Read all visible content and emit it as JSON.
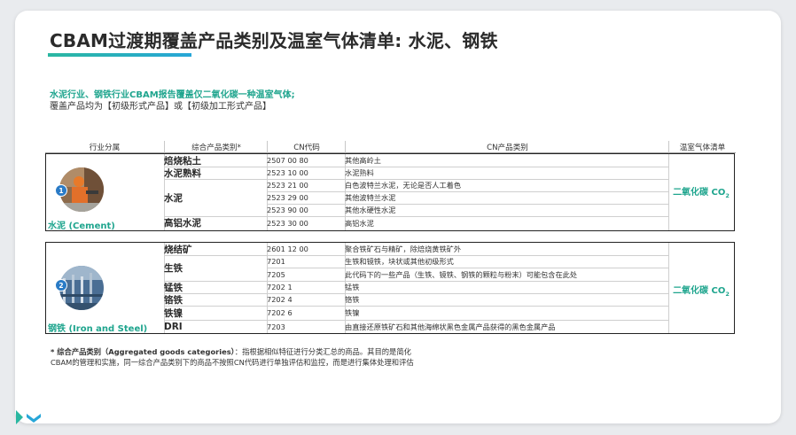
{
  "slide": {
    "title": "CBAM过渡期覆盖产品类别及温室气体清单: 水泥、钢铁",
    "subtitle_line1": "水泥行业、钢铁行业CBAM报告覆盖仅二氧化碳一种温室气体;",
    "subtitle_line2": "覆盖产品均为【初级形式产品】或【初级加工形式产品】"
  },
  "table": {
    "headers": [
      "行业分属",
      "综合产品类别*",
      "CN代码",
      "CN产品类别",
      "温室气体清单"
    ],
    "groups": [
      {
        "badge": "1",
        "sector": "水泥 (Cement)",
        "gas": "二氧化碳 CO",
        "gas_sub": "2",
        "categories": [
          "焙烧粘土",
          "水泥熟料",
          "水泥",
          "高铝水泥"
        ],
        "rows": [
          {
            "code": "2507 00 80",
            "desc": "其他高岭土"
          },
          {
            "code": "2523 10 00",
            "desc": "水泥熟料"
          },
          {
            "code": "2523 21 00",
            "desc": "白色波特兰水泥，无论是否人工着色"
          },
          {
            "code": "2523 29 00",
            "desc": "其他波特兰水泥"
          },
          {
            "code": "2523 90 00",
            "desc": "其他水硬性水泥"
          },
          {
            "code": "2523 30 00",
            "desc": "高铝水泥"
          }
        ]
      },
      {
        "badge": "2",
        "sector": "钢铁  (Iron and Steel)",
        "gas": "二氧化碳 CO",
        "gas_sub": "2",
        "categories": [
          "烧结矿",
          "生铁",
          "锰铁",
          "铬铁",
          "铁镍",
          "DRI"
        ],
        "rows": [
          {
            "code": "2601 12 00",
            "desc": "聚合铁矿石与精矿，除焙烧黄铁矿外"
          },
          {
            "code": "7201",
            "desc": "生铁和镜铁，块状或其他初级形式"
          },
          {
            "code": "7205",
            "desc": "此代码下的一些产品（生铁、镜铁、钢铁的颗粒与粉末）可能包含在此处"
          },
          {
            "code": "7202 1",
            "desc": "锰铁"
          },
          {
            "code": "7202 4",
            "desc": "铬铁"
          },
          {
            "code": "7202 6",
            "desc": "铁镍"
          },
          {
            "code": "7203",
            "desc": "由直接还原铁矿石和其他海绵状黑色金属产品获得的黑色金属产品"
          }
        ]
      }
    ]
  },
  "footnote": {
    "line1_bold": "* 综合产品类别（Aggregated goods categories）",
    "line1_rest": "：指根据相似特征进行分类汇总的商品。其目的是简化",
    "line2": "CBAM的管理和实施，同一综合产品类别下的商品不按照CN代码进行单独评估和监控，而是进行集体处理和评估"
  },
  "colors": {
    "accent": "#1fa58e",
    "title_bar_start": "#2ab7a1",
    "title_bar_end": "#27a6d8",
    "badge": "#2a7bc6"
  },
  "icons": {
    "cement_photo": "cement-worker-photo",
    "steel_photo": "steel-pipes-photo",
    "corner": "corner-chevron-icon"
  }
}
